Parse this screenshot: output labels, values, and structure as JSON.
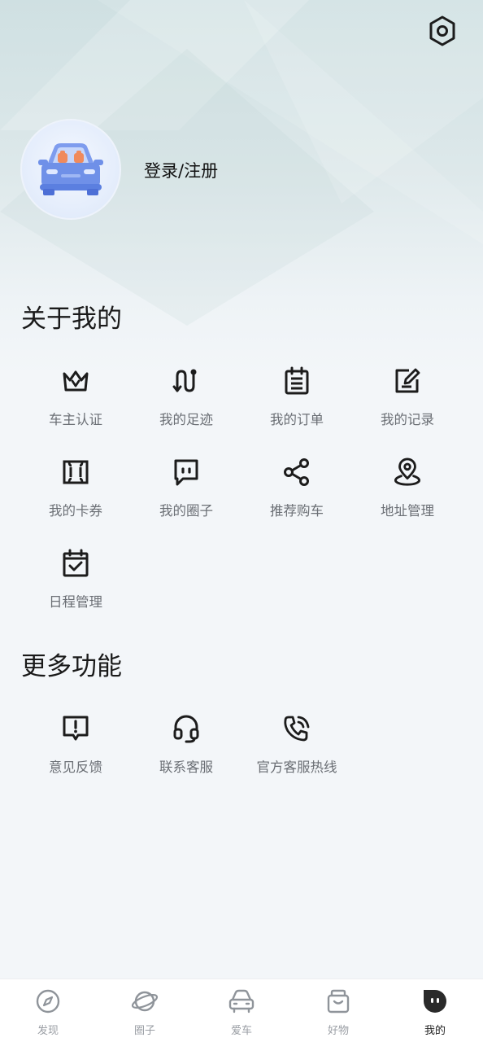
{
  "header": {
    "settings_icon": "settings-hexagon-icon",
    "login_label": "登录/注册"
  },
  "about": {
    "title": "关于我的",
    "items": [
      {
        "label": "车主认证",
        "icon": "crown-icon"
      },
      {
        "label": "我的足迹",
        "icon": "route-icon"
      },
      {
        "label": "我的订单",
        "icon": "clipboard-list-icon"
      },
      {
        "label": "我的记录",
        "icon": "edit-note-icon"
      },
      {
        "label": "我的卡券",
        "icon": "ticket-icon"
      },
      {
        "label": "我的圈子",
        "icon": "chat-square-icon"
      },
      {
        "label": "推荐购车",
        "icon": "share-icon"
      },
      {
        "label": "地址管理",
        "icon": "location-pin-icon"
      },
      {
        "label": "日程管理",
        "icon": "calendar-check-icon"
      }
    ]
  },
  "more": {
    "title": "更多功能",
    "items": [
      {
        "label": "意见反馈",
        "icon": "feedback-icon"
      },
      {
        "label": "联系客服",
        "icon": "headset-icon"
      },
      {
        "label": "官方客服热线",
        "icon": "phone-call-icon"
      }
    ]
  },
  "tabbar": {
    "active": "我的",
    "tabs": [
      {
        "label": "发现",
        "icon": "compass-icon"
      },
      {
        "label": "圈子",
        "icon": "planet-icon"
      },
      {
        "label": "爱车",
        "icon": "car-front-icon"
      },
      {
        "label": "好物",
        "icon": "shopping-bag-icon"
      },
      {
        "label": "我的",
        "icon": "profile-face-icon"
      }
    ]
  },
  "colors": {
    "icon_stroke": "#1c1c1c",
    "label_gray": "#6b6f75",
    "car_blue": "#6f90e8",
    "seat_orange": "#f08a5d"
  }
}
